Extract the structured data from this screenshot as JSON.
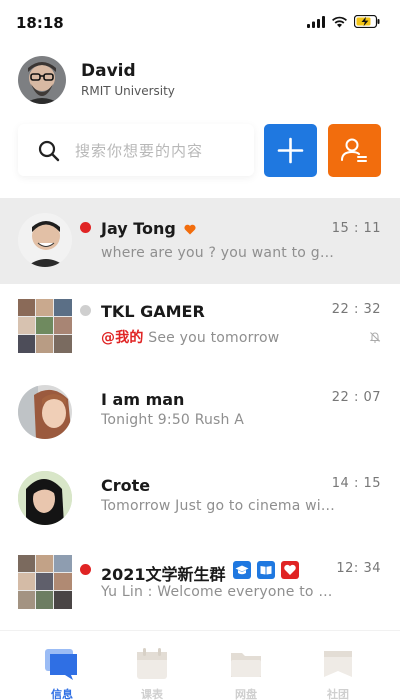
{
  "status": {
    "time": "18:18"
  },
  "profile": {
    "name": "David",
    "org": "RMIT University"
  },
  "search": {
    "placeholder": "搜索你想要的内容"
  },
  "chats": [
    {
      "name": "Jay Tong",
      "message": "where are you ? you want to go p...",
      "time": "15 : 11",
      "unread": true,
      "heart": true
    },
    {
      "name": "TKL GAMER",
      "mention": "@我的",
      "message": "See you tomorrow",
      "time": "22 : 32",
      "muted": true,
      "unread": false
    },
    {
      "name": "I am man",
      "message": "Tonight 9:50  Rush A",
      "time": "22 : 07"
    },
    {
      "name": "Crote",
      "message": "Tomorrow Just go to cinema wi...",
      "time": "14 : 15"
    },
    {
      "name": "2021文学新生群",
      "message": "Yu Lin : Welcome  everyone to t...",
      "time": "12: 34",
      "unread": true
    }
  ],
  "tabs": [
    {
      "label": "信息",
      "active": true
    },
    {
      "label": "课表",
      "active": false
    },
    {
      "label": "网盘",
      "active": false
    },
    {
      "label": "社团",
      "active": false
    }
  ],
  "colors": {
    "accent_blue": "#1f78e0",
    "accent_orange": "#f26d0d",
    "unread_red": "#e02424",
    "tab_active": "#2f6fe4"
  }
}
